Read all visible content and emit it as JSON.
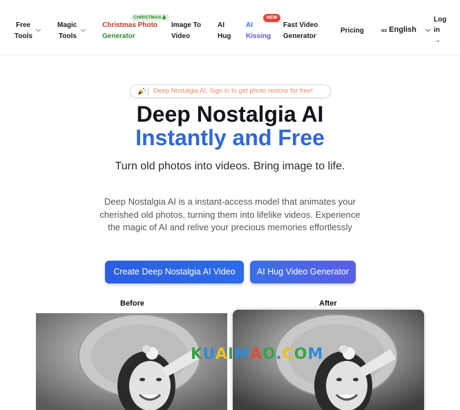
{
  "nav": {
    "free_tools": [
      "Free",
      "Tools"
    ],
    "magic_tools": [
      "Magic",
      "Tools"
    ],
    "christmas_badge": "CHRISTMAS🎄",
    "christmas_line1": "Christmas Photo",
    "christmas_line2": "Generator",
    "image_to_video": [
      "Image To",
      "Video"
    ],
    "ai_hug": [
      "AI",
      "Hug"
    ],
    "new_badge": "NEW",
    "ai_kissing": [
      "AI",
      "Kissing"
    ],
    "fast_video": [
      "Fast Video",
      "Generator"
    ],
    "pricing": "Pricing",
    "lang_flag": "us",
    "lang_label": "English",
    "login": [
      "Log",
      "in",
      "→"
    ]
  },
  "hero": {
    "pill_text": "Deep Nostalgia AI, Sign in to get photo restore for free!",
    "title_line1": "Deep Nostalgia AI",
    "title_line2": "Instantly and Free",
    "subtitle": "Turn old photos into videos. Bring image to life.",
    "description": "Deep Nostalgia AI is a instant-access model that animates your cherished old photos, turning them into lifelike videos. Experience the magic of AI and relive your precious memories effortlessly",
    "primary_button": "Create Deep Nostalgia AI Video",
    "secondary_button": "AI Hug Video Generator"
  },
  "compare": {
    "before_label": "Before",
    "after_label": "After"
  },
  "watermark": "KUAIMAO.COM",
  "colors": {
    "brand_blue": "#2e67dd",
    "title_dark": "#13151e",
    "pill_orange": "#e88a63",
    "christmas_red": "#c0352b",
    "christmas_green": "#2e8b3a",
    "new_badge_red": "#e2483c"
  }
}
